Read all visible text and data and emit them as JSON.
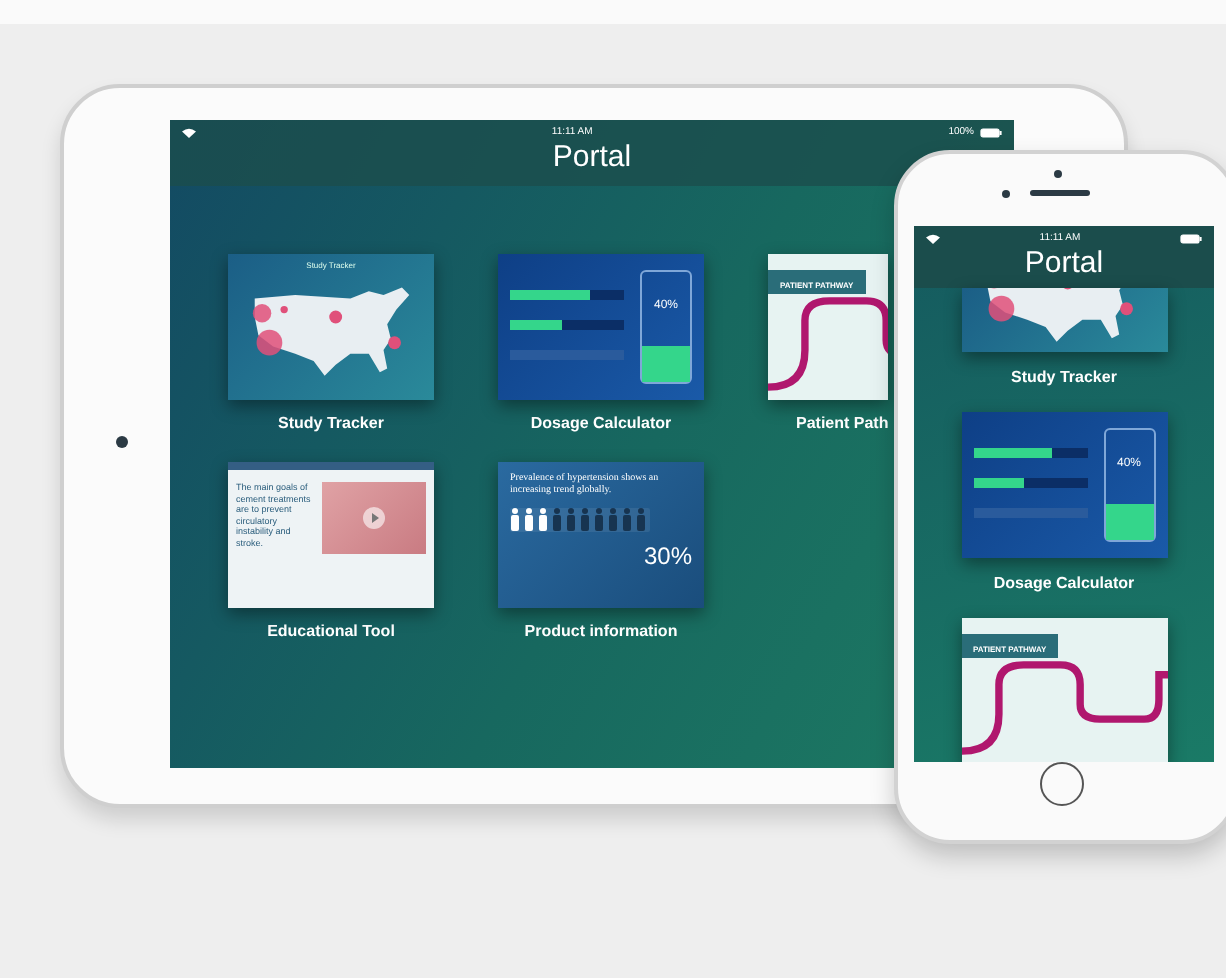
{
  "tablet": {
    "status_bar": {
      "time": "11:11 AM",
      "battery": "100%"
    },
    "title": "Portal",
    "tiles": [
      {
        "kind": "map",
        "label": "Study Tracker",
        "thumb_title": "Study Tracker"
      },
      {
        "kind": "calculator",
        "label": "Dosage Calculator",
        "thumb_value": "40%"
      },
      {
        "kind": "pathway",
        "label": "Patient Path",
        "thumb_title": "PATIENT PATHWAY"
      },
      {
        "kind": "article",
        "label": "Educational Tool",
        "thumb_text": "The main goals of cement treatments are to prevent circulatory instability and stroke."
      },
      {
        "kind": "stats",
        "label": "Product information",
        "thumb_text": "Prevalence of hypertension shows an increasing trend globally.",
        "thumb_value": "30%",
        "level": 0.3
      }
    ]
  },
  "phone": {
    "status_bar": {
      "time": "11:11 AM"
    },
    "title": "Portal",
    "tiles": [
      {
        "kind": "map",
        "label": "Study Tracker"
      },
      {
        "kind": "calculator",
        "label": "Dosage Calculator",
        "thumb_value": "40%"
      },
      {
        "kind": "pathway",
        "thumb_title": "PATIENT PATHWAY"
      }
    ]
  }
}
